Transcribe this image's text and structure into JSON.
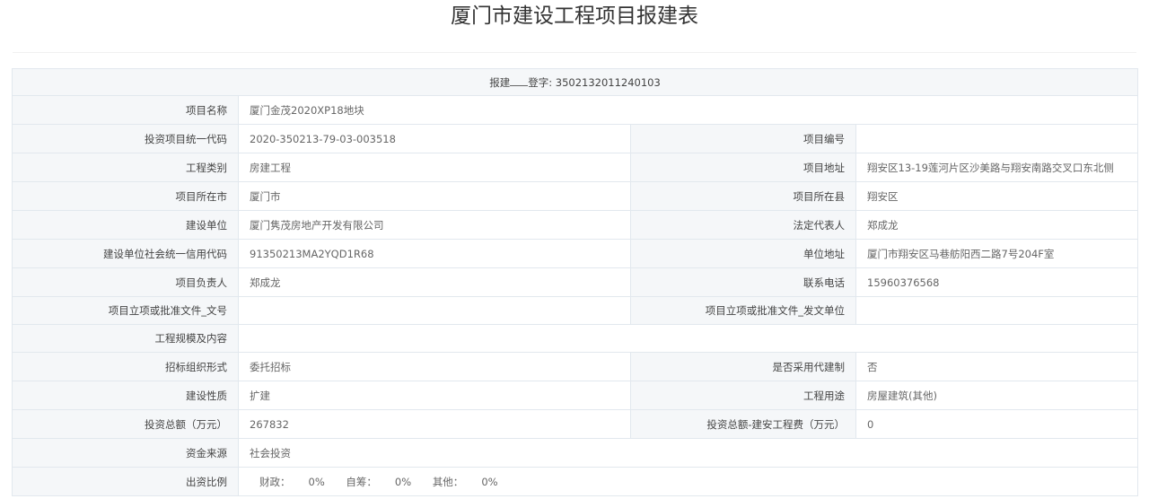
{
  "title": "厦门市建设工程项目报建表",
  "registration": {
    "prefix": "报建",
    "suffix": "登字: ",
    "number": "3502132011240103"
  },
  "fields": {
    "project_name": {
      "label": "项目名称",
      "value": "厦门金茂2020XP18地块"
    },
    "invest_code": {
      "label": "投资项目统一代码",
      "value": "2020-350213-79-03-003518"
    },
    "project_no": {
      "label": "项目编号",
      "value": ""
    },
    "eng_category": {
      "label": "工程类别",
      "value": "房建工程"
    },
    "project_address": {
      "label": "项目地址",
      "value": "翔安区13-19莲河片区沙美路与翔安南路交叉口东北侧"
    },
    "city": {
      "label": "项目所在市",
      "value": "厦门市"
    },
    "county": {
      "label": "项目所在县",
      "value": "翔安区"
    },
    "build_unit": {
      "label": "建设单位",
      "value": "厦门隽茂房地产开发有限公司"
    },
    "legal_rep": {
      "label": "法定代表人",
      "value": "郑成龙"
    },
    "credit_code": {
      "label": "建设单位社会统一信用代码",
      "value": "91350213MA2YQD1R68"
    },
    "unit_address": {
      "label": "单位地址",
      "value": "厦门市翔安区马巷舫阳西二路7号204F室"
    },
    "project_leader": {
      "label": "项目负责人",
      "value": "郑成龙"
    },
    "phone": {
      "label": "联系电话",
      "value": "15960376568"
    },
    "approval_doc_no": {
      "label": "项目立项或批准文件_文号",
      "value": ""
    },
    "approval_doc_unit": {
      "label": "项目立项或批准文件_发文单位",
      "value": ""
    },
    "scale_content": {
      "label": "工程规模及内容",
      "value": ""
    },
    "bidding_form": {
      "label": "招标组织形式",
      "value": "委托招标"
    },
    "agent_system": {
      "label": "是否采用代建制",
      "value": "否"
    },
    "build_nature": {
      "label": "建设性质",
      "value": "扩建"
    },
    "eng_usage": {
      "label": "工程用途",
      "value": "房屋建筑(其他)"
    },
    "total_invest": {
      "label": "投资总额（万元）",
      "value": "267832"
    },
    "build_install_fee": {
      "label": "投资总额-建安工程费（万元）",
      "value": "0"
    },
    "fund_source": {
      "label": "资金来源",
      "value": "社会投资"
    }
  },
  "funding_ratio": {
    "label": "出资比例",
    "items": [
      {
        "label": "财政：",
        "value": "0%"
      },
      {
        "label": "自筹：",
        "value": "0%"
      },
      {
        "label": "其他：",
        "value": "0%"
      }
    ]
  }
}
